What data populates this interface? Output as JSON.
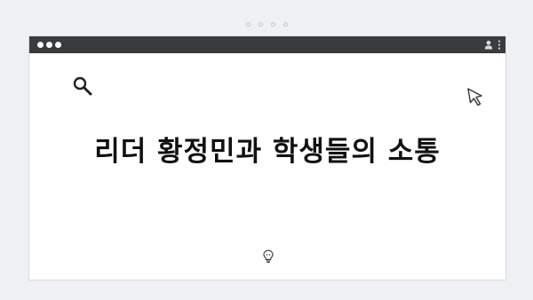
{
  "headline": {
    "text": "리더 황정민과 학생들의 소통"
  },
  "icons": {
    "search": "search-icon",
    "cursor": "cursor-icon",
    "user": "user-icon",
    "menu": "kebab-menu-icon",
    "bulb": "lightbulb-icon"
  },
  "colors": {
    "titlebar": "#3a3b3d",
    "background": "#eef0f3",
    "text": "#111111"
  }
}
